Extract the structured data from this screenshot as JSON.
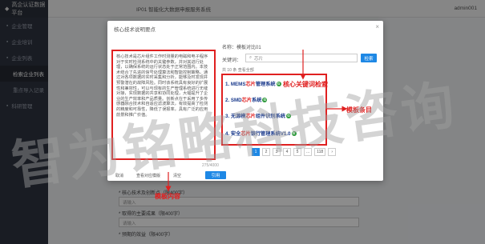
{
  "app": {
    "title": "高企认证数据平台",
    "top_tab": "IP01 智能化大数据申报服务系统",
    "user": "admin001"
  },
  "sidebar": {
    "items": [
      {
        "label": "企业管理"
      },
      {
        "label": "企业培训"
      },
      {
        "label": "企业列表"
      },
      {
        "label": "检索企业列表"
      },
      {
        "label": "重点导入记录"
      },
      {
        "label": "科研管理"
      }
    ]
  },
  "modal": {
    "title": "核心技术说明要点",
    "left_text": "核心技术是芯片组件工作时测量的电磁和电子程序对于实时检测系统中的关键参数，并对其进行处理，以确保系统的运行状态处于正常范围内。本技术结合了先进的信号处理算法和智能控制策略，通过对各项数据的实时采集和分析，能够及时发现并预警潜在的故障风险。同时该系统具有良好的扩展性和兼容性，可以与现有的生产管理系统进行无缝对接，实现数据的共享和协同处理，大幅提升了企业的生产效率和产品质量。创新点在于采用了多传感器融合技术和自适应滤波算法，有效提高了检测的精度和可靠性，降低了误报率，具有广泛的应用前景和推广价值。",
    "char_count": "275/4000",
    "name_label": "名称：",
    "name_value": "模板对比01",
    "keyword_label": "关键词：",
    "keyword_value": "芯片",
    "search_button": "检索",
    "result_meta": "共 10 条   查看全部",
    "results": [
      {
        "pre": "1. MEMS",
        "hl": "芯片",
        "post": "管理系统",
        "badge": "G"
      },
      {
        "pre": "2. SMD",
        "hl": "芯片",
        "post": "系统",
        "badge": "G"
      },
      {
        "pre": "3. 无源模",
        "hl": "芯片",
        "post": "组件识别系统",
        "badge": "G"
      },
      {
        "pre": "4. 安全",
        "hl": "芯片",
        "post": "银行管理系统V1.0",
        "badge": "G"
      }
    ],
    "pager": [
      "1",
      "2",
      "3",
      "4",
      "5",
      "...",
      "118",
      "›"
    ],
    "footer": {
      "link1": "取消",
      "link2": "查看对应模版",
      "link3": "清空",
      "ok": "引用"
    }
  },
  "form": {
    "line1": "* 核心技术及创新点（限400字）",
    "line2": "* 取得的主要成果（限400字）",
    "line3": "* 预期的效益（限400字）",
    "placeholder": "请输入"
  },
  "annotations": {
    "template_content": "模板内容",
    "keyword_search": "核心关键词检索",
    "template_items": "模板条目"
  },
  "watermark": "智为铭略科技咨询",
  "colors": {
    "accent": "#1e88e5",
    "annotation": "#e02020",
    "sidebar": "#2f3441",
    "result_title": "#1a3a8c"
  }
}
